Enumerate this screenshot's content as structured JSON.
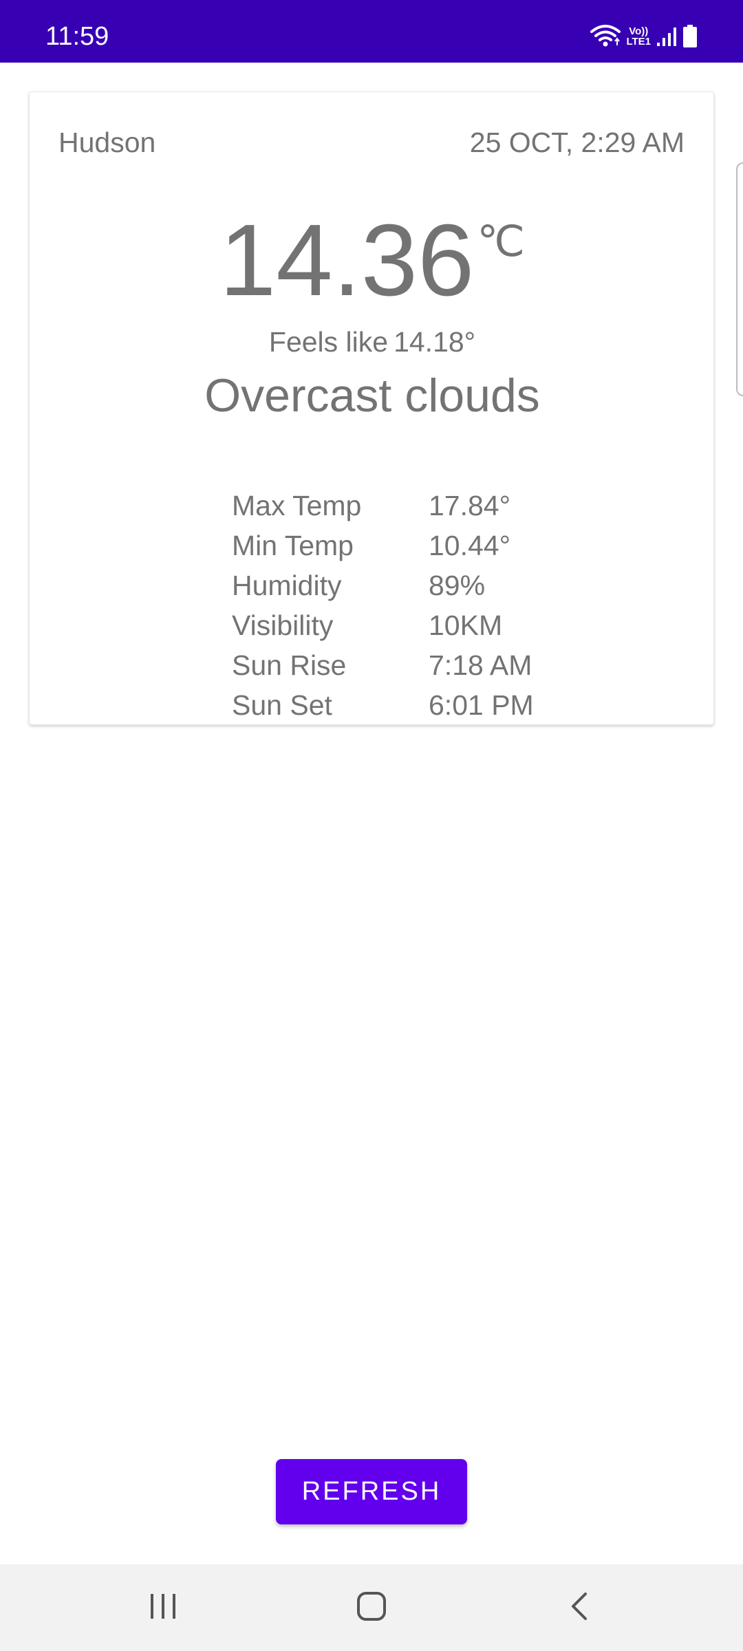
{
  "status_bar": {
    "time": "11:59",
    "network_label_top": "Vo))",
    "network_label_bottom": "LTE1",
    "background": "#3700b3"
  },
  "card": {
    "city": "Hudson",
    "datetime": "25 OCT, 2:29 AM",
    "temperature": "14.36",
    "unit": "℃",
    "feels_like_label": "Feels like",
    "feels_like_value": "14.18°",
    "condition": "Overcast clouds",
    "details": [
      {
        "label": "Max Temp",
        "value": "17.84°"
      },
      {
        "label": "Min Temp",
        "value": "10.44°"
      },
      {
        "label": "Humidity",
        "value": "89%"
      },
      {
        "label": "Visibility",
        "value": "10KM"
      },
      {
        "label": "Sun Rise",
        "value": "7:18 AM"
      },
      {
        "label": "Sun Set",
        "value": "6:01 PM"
      }
    ]
  },
  "refresh_button": {
    "label": "REFRESH",
    "color": "#6200ee"
  },
  "nav_bar": {
    "icons": [
      "recent-apps-icon",
      "home-icon",
      "back-icon"
    ]
  }
}
